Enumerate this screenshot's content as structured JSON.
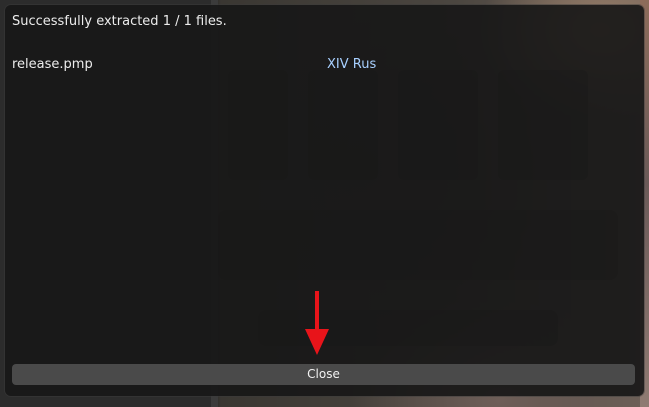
{
  "dialog": {
    "title": "Successfully extracted 1 / 1 files.",
    "files": [
      {
        "file_name": "release.pmp",
        "mod_name": "XIV Rus"
      }
    ],
    "close_label": "Close"
  },
  "colors": {
    "dialog_background": "#171717",
    "text": "#ececec",
    "link_text": "#a8d0ff",
    "button": "#4a4a4a",
    "annotation_arrow": "#e8141a"
  },
  "icons": {
    "annotation": "red-down-arrow-icon"
  }
}
